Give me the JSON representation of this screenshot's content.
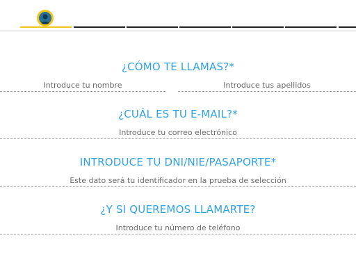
{
  "stepper": {
    "steps": [
      "avatar",
      "step-2",
      "step-3",
      "step-4",
      "step-5",
      "step-6",
      "step-7"
    ],
    "active_step": 1
  },
  "form": {
    "name_question": "¿CÓMO TE LLAMAS?*",
    "name_placeholder": "Introduce tu nombre",
    "surname_placeholder": "Introduce tus apellidos",
    "email_question": "¿CUÁL ES TU E-MAIL?*",
    "email_placeholder": "Introduce tu correo electrónico",
    "id_question": "INTRODUCE TU DNI/NIE/PASAPORTE*",
    "id_placeholder": "Este dato será tu identificador en la prueba de selección",
    "phone_question": "¿Y SI QUEREMOS LLAMARTE?",
    "phone_placeholder": "Introduce tu número de teléfono"
  },
  "colors": {
    "accent": "#2fa2e6",
    "progress": "#f2c51a",
    "avatar": "#2b6f97"
  }
}
